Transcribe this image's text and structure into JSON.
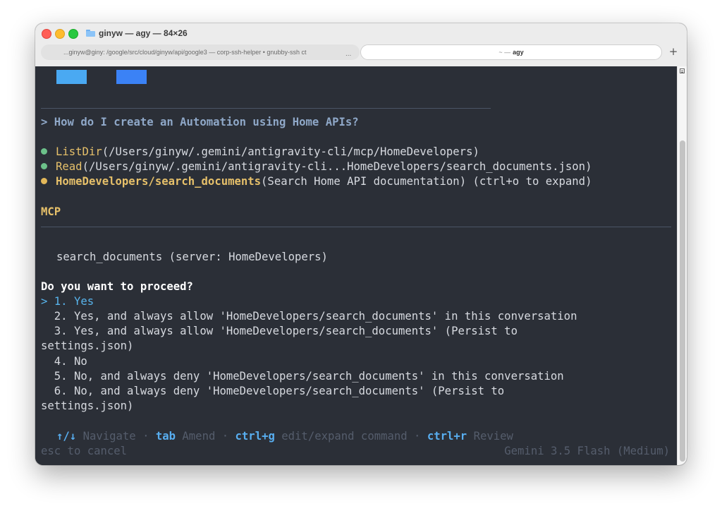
{
  "window": {
    "title": "ginyw — agy — 84×26"
  },
  "tabs": [
    {
      "label": "...ginyw@giny: /google/src/cloud/ginyw/api/google3 — corp-ssh-helper • gnubby-ssh ct",
      "active": false
    },
    {
      "label_tilde": "~ —",
      "label": "agy",
      "active": true
    }
  ],
  "tab_overflow": "...",
  "new_tab_label": "+",
  "terminal": {
    "prompt_marker": ">",
    "user_prompt": "How do I create an Automation using Home APIs?",
    "tool_calls": [
      {
        "status": "done",
        "status_color": "#6cc18a",
        "name": "ListDir",
        "args": "(/Users/ginyw/.gemini/antigravity-cli/mcp/HomeDevelopers)"
      },
      {
        "status": "done",
        "status_color": "#6cc18a",
        "name": "Read",
        "args": "(/Users/ginyw/.gemini/antigravity-cli...HomeDevelopers/search_documents.json)"
      },
      {
        "status": "pending",
        "status_color": "#e3b85a",
        "name": "HomeDevelopers/search_documents",
        "args": "(Search Home API documentation) (ctrl+o to expand)"
      }
    ],
    "section_label": "MCP",
    "tool_description": "search_documents (server: HomeDevelopers)",
    "question": "Do you want to proceed?",
    "options": [
      {
        "marker": "> ",
        "text": "1. Yes",
        "selected": true
      },
      {
        "marker": "  ",
        "text": "2. Yes, and always allow 'HomeDevelopers/search_documents' in this conversation",
        "selected": false
      },
      {
        "marker": "  ",
        "text": "3. Yes, and always allow 'HomeDevelopers/search_documents' (Persist to",
        "selected": false
      },
      {
        "marker": "",
        "text": "settings.json)",
        "selected": false
      },
      {
        "marker": "  ",
        "text": "4. No",
        "selected": false
      },
      {
        "marker": "  ",
        "text": "5. No, and always deny 'HomeDevelopers/search_documents' in this conversation",
        "selected": false
      },
      {
        "marker": "  ",
        "text": "6. No, and always deny 'HomeDevelopers/search_documents' (Persist to",
        "selected": false
      },
      {
        "marker": "",
        "text": "settings.json)",
        "selected": false
      }
    ],
    "hints": {
      "navigate_key": "↑/↓",
      "navigate_label": "Navigate",
      "separator": "·",
      "amend_key": "tab",
      "amend_label": "Amend",
      "edit_key": "ctrl+g",
      "edit_label": "edit/expand command",
      "review_key": "ctrl+r",
      "review_label": "Review"
    },
    "cancel_hint": "esc to cancel",
    "model_label": "Gemini 3.5 Flash (Medium)"
  },
  "colors": {
    "terminal_bg": "#2b2f37",
    "accent_blue": "#58b4ec",
    "tool_yellow": "#e6c06a",
    "status_green": "#6cc18a",
    "status_yellow": "#e3b85a",
    "logo_block_1": "#4aa9f2",
    "logo_block_2": "#3b82f6"
  }
}
